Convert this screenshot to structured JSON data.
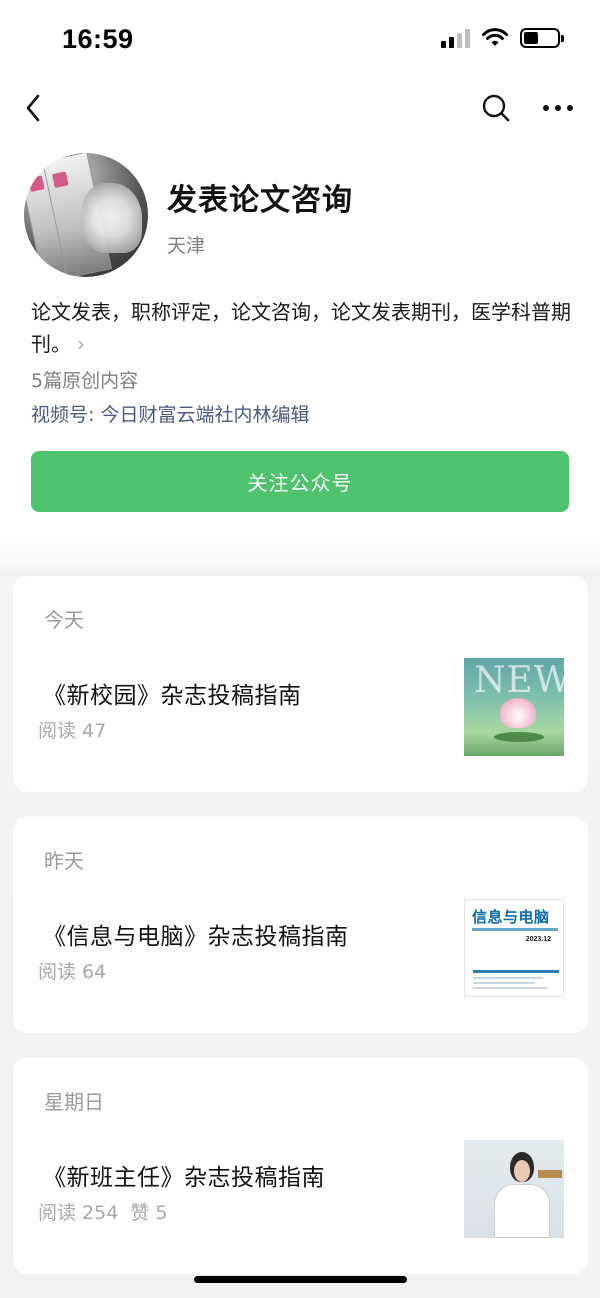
{
  "status_bar": {
    "time": "16:59",
    "icons": [
      "signal-icon",
      "wifi-icon",
      "battery-icon"
    ]
  },
  "nav": {
    "icons": [
      "back-icon",
      "search-icon",
      "more-icon"
    ]
  },
  "profile": {
    "name": "发表论文咨询",
    "location": "天津",
    "description": "论文发表，职称评定，论文咨询，论文发表期刊，医学科普期刊。",
    "original_count": "5篇原创内容",
    "video_channel": "视频号: 今日财富云端社内林编辑",
    "follow_label": "关注公众号"
  },
  "articles": [
    {
      "day": "今天",
      "title": "《新校园》杂志投稿指南",
      "reads": "阅读 47",
      "likes": "",
      "thumb": "new-campus-lotus-cover"
    },
    {
      "day": "昨天",
      "title": "《信息与电脑》杂志投稿指南",
      "reads": "阅读 64",
      "likes": "",
      "thumb": "info-computer-cover"
    },
    {
      "day": "星期日",
      "title": "《新班主任》杂志投稿指南",
      "reads": "阅读 254",
      "likes": "赞 5",
      "thumb": "new-head-teacher-cover"
    }
  ],
  "thumb_text": {
    "new_word": "NEW",
    "info_title": "信息与电脑",
    "info_issue": "2023.12"
  },
  "colors": {
    "follow_button": "#4ec26c",
    "link": "#4a5a86",
    "muted_text": "#7f7f7f"
  }
}
